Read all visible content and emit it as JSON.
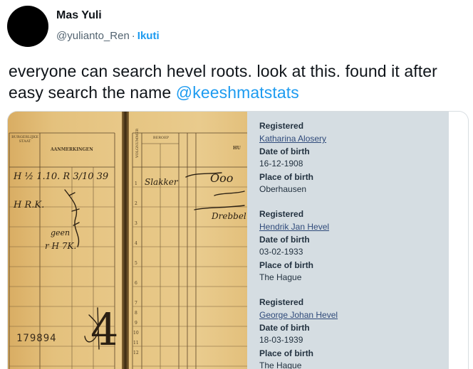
{
  "author": {
    "name": "Mas Yuli",
    "handle": "@yulianto_Ren",
    "separator": "·",
    "follow_label": "Ikuti"
  },
  "tweet": {
    "text_before": "everyone can search hevel roots. look at this. found it after easy search the name ",
    "mention": "@keeshmatstats"
  },
  "scan": {
    "number": "179894",
    "big_mark": "4",
    "col_bs": "BURGERLIJKE STAAT",
    "col_remarks": "AANMERKINGEN",
    "col_volgnummer": "VOLGNUMMER",
    "col_beroep": "BEROEP",
    "col_hu": "HU",
    "row_numbers": [
      "1",
      "2",
      "3",
      "4",
      "5",
      "6",
      "7",
      "8",
      "9",
      "10",
      "11",
      "12"
    ],
    "hw_line1": "H  ½  1.10.  R  3/10 39",
    "hw_line2": "H      R.K.",
    "hw_line3": "geen",
    "hw_line4": "r H  7K.",
    "hw_right1": "Slakker",
    "hw_right2": "Ooo",
    "hw_right3": "Drebbel"
  },
  "records": [
    {
      "registered_label": "Registered",
      "name": "Katharina Alosery",
      "dob_label": "Date of birth",
      "dob": "16-12-1908",
      "pob_label": "Place of birth",
      "pob": "Oberhausen"
    },
    {
      "registered_label": "Registered",
      "name": "Hendrik Jan Hevel",
      "dob_label": "Date of birth",
      "dob": "03-02-1933",
      "pob_label": "Place of birth",
      "pob": "The Hague"
    },
    {
      "registered_label": "Registered",
      "name": "George Johan Hevel",
      "dob_label": "Date of birth",
      "dob": "18-03-1939",
      "pob_label": "Place of birth",
      "pob": "The Hague"
    }
  ],
  "colors": {
    "link": "#1d9bf0",
    "panel_bg": "#d5dde2",
    "card_paper": "#e2bd77"
  }
}
